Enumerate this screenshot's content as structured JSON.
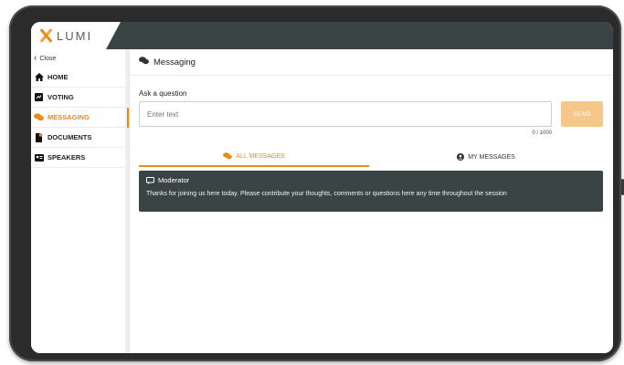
{
  "app": {
    "logo_text": "LUMI",
    "brand_color": "#e98b14",
    "topbar_color": "#3b4445"
  },
  "sidebar": {
    "close_label": "Close",
    "items": [
      {
        "label": "HOME",
        "icon": "home-icon",
        "active": false
      },
      {
        "label": "VOTING",
        "icon": "voting-icon",
        "active": false
      },
      {
        "label": "MESSAGING",
        "icon": "chat-icon",
        "active": true
      },
      {
        "label": "DOCUMENTS",
        "icon": "document-icon",
        "active": false
      },
      {
        "label": "SPEAKERS",
        "icon": "speakers-icon",
        "active": false
      }
    ]
  },
  "main": {
    "title": "Messaging",
    "ask_label": "Ask a question",
    "input_placeholder": "Enter text",
    "input_value": "",
    "counter": "0 / 1000",
    "send_label": "SEND",
    "tabs": [
      {
        "label": "ALL MESSAGES",
        "icon": "chat-icon",
        "active": true
      },
      {
        "label": "MY MESSAGES",
        "icon": "user-circle-icon",
        "active": false
      }
    ],
    "messages": [
      {
        "author": "Moderator",
        "icon": "moderator-icon",
        "text": "Thanks for joining us here today. Please contribute your thoughts, comments or questions here any time throughout the session"
      }
    ]
  }
}
